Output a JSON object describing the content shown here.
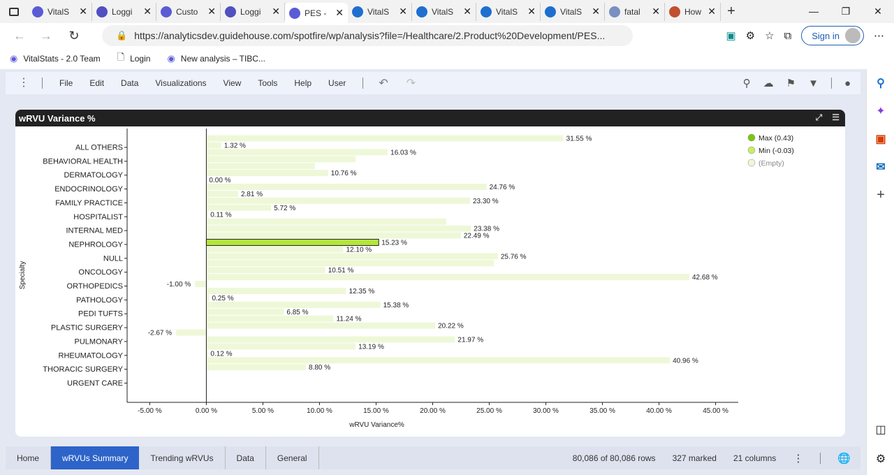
{
  "browser": {
    "tabs": [
      {
        "label": "VitalS",
        "icon": "tibco-icon",
        "color": "#5b5bd6"
      },
      {
        "label": "Loggi",
        "icon": "app-icon",
        "color": "#5050c0"
      },
      {
        "label": "Custo",
        "icon": "tibco-icon",
        "color": "#5b5bd6"
      },
      {
        "label": "Loggi",
        "icon": "app-icon",
        "color": "#5050c0"
      },
      {
        "label": "PES -",
        "icon": "tibco-icon",
        "color": "#5b5bd6",
        "active": true
      },
      {
        "label": "VitalS",
        "icon": "azure-devops-icon",
        "color": "#1e6fd0"
      },
      {
        "label": "VitalS",
        "icon": "azure-devops-icon",
        "color": "#1e6fd0"
      },
      {
        "label": "VitalS",
        "icon": "azure-devops-icon",
        "color": "#1e6fd0"
      },
      {
        "label": "VitalS",
        "icon": "azure-devops-icon",
        "color": "#1e6fd0"
      },
      {
        "label": "fatal",
        "icon": "search-icon",
        "color": "#7a8fc2"
      },
      {
        "label": "How",
        "icon": "arc-icon",
        "color": "#c05030"
      }
    ],
    "url": "https://analyticsdev.guidehouse.com/spotfire/wp/analysis?file=/Healthcare/2.Product%20Development/PES...",
    "signin_label": "Sign in",
    "bookmarks": [
      {
        "label": "VitalStats - 2.0 Team",
        "icon": "azure-devops-icon"
      },
      {
        "label": "Login",
        "icon": "page-icon"
      },
      {
        "label": "New analysis – TIBC...",
        "icon": "tibco-icon"
      }
    ]
  },
  "menubar": {
    "items": [
      "File",
      "Edit",
      "Data",
      "Visualizations",
      "View",
      "Tools",
      "Help",
      "User"
    ]
  },
  "panel": {
    "title": "wRVU Variance %"
  },
  "chart_data": {
    "type": "bar",
    "orientation": "horizontal",
    "title": "wRVU Variance %",
    "xlabel": "wRVU Variance%",
    "ylabel": "Specialty",
    "xlim": [
      -7,
      47
    ],
    "xticks": [
      "-5.00 %",
      "0.00 %",
      "5.00 %",
      "10.00 %",
      "15.00 %",
      "20.00 %",
      "25.00 %",
      "30.00 %",
      "35.00 %",
      "40.00 %",
      "45.00 %"
    ],
    "xtick_values": [
      -5,
      0,
      5,
      10,
      15,
      20,
      25,
      30,
      35,
      40,
      45
    ],
    "categories": [
      "ALL OTHERS",
      "BEHAVIORAL HEALTH",
      "DERMATOLOGY",
      "ENDOCRINOLOGY",
      "FAMILY PRACTICE",
      "HOSPITALIST",
      "INTERNAL MED",
      "NEPHROLOGY",
      "NULL",
      "ONCOLOGY",
      "ORTHOPEDICS",
      "PATHOLOGY",
      "PEDI TUFTS",
      "PLASTIC SURGERY",
      "PULMONARY",
      "RHEUMATOLOGY",
      "THORACIC SURGERY",
      "URGENT CARE"
    ],
    "bars": [
      {
        "value": 31.55,
        "label": "31.55 %"
      },
      {
        "value": 1.32,
        "label": "1.32 %"
      },
      {
        "value": 16.03,
        "label": "16.03 %"
      },
      {
        "value": 13.2,
        "label": ""
      },
      {
        "value": 9.6,
        "label": ""
      },
      {
        "value": 10.76,
        "label": "10.76 %"
      },
      {
        "value": 0.0,
        "label": "0.00 %"
      },
      {
        "value": 24.76,
        "label": "24.76 %"
      },
      {
        "value": 2.81,
        "label": "2.81 %"
      },
      {
        "value": 23.3,
        "label": "23.30 %"
      },
      {
        "value": 5.72,
        "label": "5.72 %"
      },
      {
        "value": 0.11,
        "label": "0.11 %"
      },
      {
        "value": 21.2,
        "label": ""
      },
      {
        "value": 23.38,
        "label": "23.38 %"
      },
      {
        "value": 22.49,
        "label": "22.49 %"
      },
      {
        "value": 15.23,
        "label": "15.23 %",
        "marked": true
      },
      {
        "value": 12.1,
        "label": "12.10 %"
      },
      {
        "value": 25.76,
        "label": "25.76 %"
      },
      {
        "value": 25.4,
        "label": ""
      },
      {
        "value": 10.51,
        "label": "10.51 %"
      },
      {
        "value": 42.68,
        "label": "42.68 %"
      },
      {
        "value": -1.0,
        "label": "-1.00 %"
      },
      {
        "value": 12.35,
        "label": "12.35 %"
      },
      {
        "value": 0.25,
        "label": "0.25 %"
      },
      {
        "value": 15.38,
        "label": "15.38 %"
      },
      {
        "value": 6.85,
        "label": "6.85 %"
      },
      {
        "value": 11.24,
        "label": "11.24 %"
      },
      {
        "value": 20.22,
        "label": "20.22 %"
      },
      {
        "value": -2.67,
        "label": "-2.67 %"
      },
      {
        "value": 21.97,
        "label": "21.97 %"
      },
      {
        "value": 13.19,
        "label": "13.19 %"
      },
      {
        "value": 0.12,
        "label": "0.12 %"
      },
      {
        "value": 40.96,
        "label": "40.96 %"
      },
      {
        "value": 8.8,
        "label": "8.80 %"
      }
    ],
    "legend": {
      "placement": "top-right",
      "items": [
        {
          "label": "Max (0.43)",
          "color": "#7ac70c"
        },
        {
          "label": "Min (-0.03)",
          "color": "#c8ee66"
        },
        {
          "label": "(Empty)",
          "color": "#eef8d8"
        }
      ]
    },
    "colors": {
      "bar": "#eef8d8",
      "marked_bar": "#b4e63c"
    }
  },
  "statusbar": {
    "tabs": [
      "Home",
      "wRVUs Summary",
      "Trending wRVUs",
      "Data",
      "General"
    ],
    "active_tab": "wRVUs Summary",
    "rows": "80,086 of 80,086 rows",
    "marked": "327 marked",
    "columns": "21 columns"
  }
}
